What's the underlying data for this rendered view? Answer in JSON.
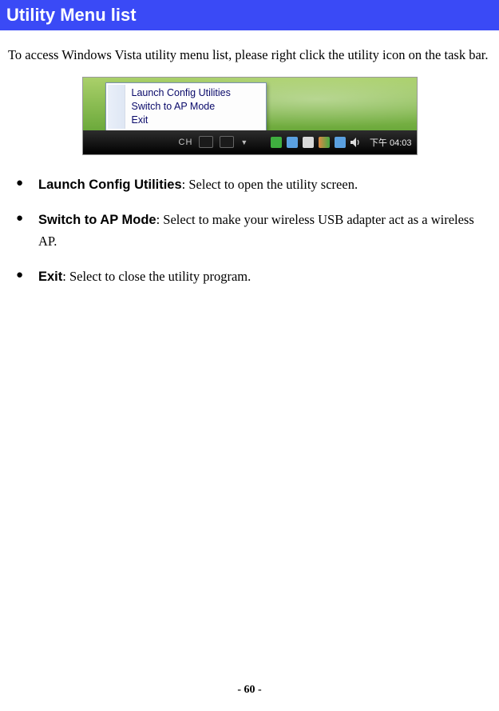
{
  "header": {
    "title": "Utility Menu list"
  },
  "intro": "To access Windows Vista utility menu list, please right click the utility icon on the task bar.",
  "context_menu": {
    "items": [
      "Launch Config Utilities",
      "Switch to AP Mode",
      "Exit"
    ]
  },
  "taskbar": {
    "ime": "CH",
    "clock": "下午 04:03"
  },
  "bullets": [
    {
      "term": "Launch Config Utilities",
      "desc": ": Select to open the utility screen."
    },
    {
      "term": "Switch to AP Mode",
      "desc": ": Select to make your wireless USB adapter act as a wireless AP."
    },
    {
      "term": "Exit",
      "desc": ": Select to close the utility program."
    }
  ],
  "page_number": "- 60 -"
}
